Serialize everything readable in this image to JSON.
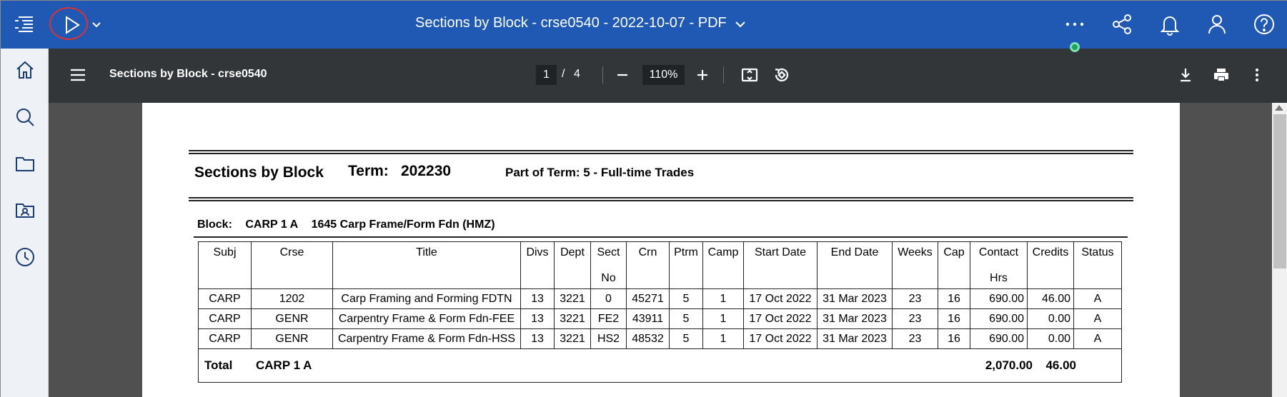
{
  "appbar": {
    "title": "Sections by Block - crse0540 - 2022-10-07 - PDF"
  },
  "viewer": {
    "title": "Sections by Block - crse0540",
    "page_current": "1",
    "page_separator": "/",
    "page_total": "4",
    "zoom": "110%"
  },
  "report": {
    "title": "Sections by Block",
    "term_label": "Term:",
    "term_value": "202230",
    "part_of_term": "Part of Term: 5 - Full-time Trades",
    "block_label": "Block:",
    "block_code": "CARP 1 A",
    "block_desc": "1645 Carp Frame/Form Fdn (HMZ)",
    "columns": [
      {
        "l1": "Subj",
        "l2": ""
      },
      {
        "l1": "Crse",
        "l2": ""
      },
      {
        "l1": "Title",
        "l2": ""
      },
      {
        "l1": "Divs",
        "l2": ""
      },
      {
        "l1": "Dept",
        "l2": ""
      },
      {
        "l1": "Sect",
        "l2": "No"
      },
      {
        "l1": "Crn",
        "l2": ""
      },
      {
        "l1": "Ptrm",
        "l2": ""
      },
      {
        "l1": "Camp",
        "l2": ""
      },
      {
        "l1": "Start Date",
        "l2": ""
      },
      {
        "l1": "End Date",
        "l2": ""
      },
      {
        "l1": "Weeks",
        "l2": ""
      },
      {
        "l1": "Cap",
        "l2": ""
      },
      {
        "l1": "Contact",
        "l2": "Hrs"
      },
      {
        "l1": "Credits",
        "l2": ""
      },
      {
        "l1": "Status",
        "l2": ""
      }
    ],
    "rows": [
      [
        "CARP",
        "1202",
        "Carp Framing and Forming FDTN",
        "13",
        "3221",
        "0",
        "45271",
        "5",
        "1",
        "17 Oct 2022",
        "31 Mar 2023",
        "23",
        "16",
        "690.00",
        "46.00",
        "A"
      ],
      [
        "CARP",
        "GENR",
        "Carpentry Frame & Form Fdn-FEE",
        "13",
        "3221",
        "FE2",
        "43911",
        "5",
        "1",
        "17 Oct 2022",
        "31 Mar 2023",
        "23",
        "16",
        "690.00",
        "0.00",
        "A"
      ],
      [
        "CARP",
        "GENR",
        "Carpentry Frame & Form Fdn-HSS",
        "13",
        "3221",
        "HS2",
        "48532",
        "5",
        "1",
        "17 Oct 2022",
        "31 Mar 2023",
        "23",
        "16",
        "690.00",
        "0.00",
        "A"
      ]
    ],
    "total_label": "Total",
    "total_block": "CARP 1 A",
    "total_hrs": "2,070.00",
    "total_credits": "46.00"
  },
  "colors": {
    "appbar": "#1f59b3",
    "toolbar": "#323639",
    "viewer_bg": "#505050",
    "run_highlight": "#e03030",
    "status_dot": "#1ea35a"
  }
}
